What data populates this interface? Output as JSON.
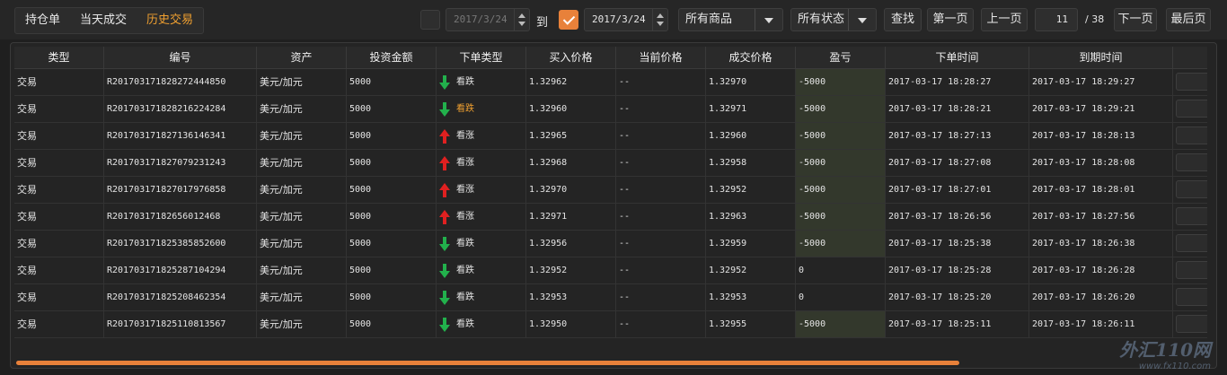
{
  "tabs": [
    {
      "label": "持仓单",
      "active": false
    },
    {
      "label": "当天成交",
      "active": false
    },
    {
      "label": "历史交易",
      "active": true
    }
  ],
  "filters": {
    "start_date": "2017/3/24",
    "to_label": "到",
    "end_date": "2017/3/24",
    "product_select": "所有商品",
    "status_select": "所有状态",
    "search_label": "查找"
  },
  "pagination": {
    "first_label": "第一页",
    "prev_label": "上一页",
    "current_page": "11",
    "total_pages": "/ 38",
    "next_label": "下一页",
    "last_label": "最后页"
  },
  "columns": [
    "类型",
    "编号",
    "资产",
    "投资金额",
    "下单类型",
    "买入价格",
    "当前价格",
    "成交价格",
    "盈亏",
    "下单时间",
    "到期时间"
  ],
  "rows": [
    {
      "type": "交易",
      "id": "R201703171828272444850",
      "asset": "美元/加元",
      "amount": "5000",
      "dir": "down",
      "dir_label": "看跌",
      "dir_highlight": false,
      "buy": "1.32962",
      "current": "--",
      "deal": "1.32970",
      "pl": "-5000",
      "pl_neg": true,
      "order_time": "2017-03-17 18:28:27",
      "expire_time": "2017-03-17 18:29:27"
    },
    {
      "type": "交易",
      "id": "R201703171828216224284",
      "asset": "美元/加元",
      "amount": "5000",
      "dir": "down",
      "dir_label": "看跌",
      "dir_highlight": true,
      "buy": "1.32960",
      "current": "--",
      "deal": "1.32971",
      "pl": "-5000",
      "pl_neg": true,
      "order_time": "2017-03-17 18:28:21",
      "expire_time": "2017-03-17 18:29:21"
    },
    {
      "type": "交易",
      "id": "R201703171827136146341",
      "asset": "美元/加元",
      "amount": "5000",
      "dir": "up",
      "dir_label": "看涨",
      "dir_highlight": false,
      "buy": "1.32965",
      "current": "--",
      "deal": "1.32960",
      "pl": "-5000",
      "pl_neg": true,
      "order_time": "2017-03-17 18:27:13",
      "expire_time": "2017-03-17 18:28:13"
    },
    {
      "type": "交易",
      "id": "R201703171827079231243",
      "asset": "美元/加元",
      "amount": "5000",
      "dir": "up",
      "dir_label": "看涨",
      "dir_highlight": false,
      "buy": "1.32968",
      "current": "--",
      "deal": "1.32958",
      "pl": "-5000",
      "pl_neg": true,
      "order_time": "2017-03-17 18:27:08",
      "expire_time": "2017-03-17 18:28:08"
    },
    {
      "type": "交易",
      "id": "R201703171827017976858",
      "asset": "美元/加元",
      "amount": "5000",
      "dir": "up",
      "dir_label": "看涨",
      "dir_highlight": false,
      "buy": "1.32970",
      "current": "--",
      "deal": "1.32952",
      "pl": "-5000",
      "pl_neg": true,
      "order_time": "2017-03-17 18:27:01",
      "expire_time": "2017-03-17 18:28:01"
    },
    {
      "type": "交易",
      "id": "R20170317182656012468",
      "asset": "美元/加元",
      "amount": "5000",
      "dir": "up",
      "dir_label": "看涨",
      "dir_highlight": false,
      "buy": "1.32971",
      "current": "--",
      "deal": "1.32963",
      "pl": "-5000",
      "pl_neg": true,
      "order_time": "2017-03-17 18:26:56",
      "expire_time": "2017-03-17 18:27:56"
    },
    {
      "type": "交易",
      "id": "R201703171825385852600",
      "asset": "美元/加元",
      "amount": "5000",
      "dir": "down",
      "dir_label": "看跌",
      "dir_highlight": false,
      "buy": "1.32956",
      "current": "--",
      "deal": "1.32959",
      "pl": "-5000",
      "pl_neg": true,
      "order_time": "2017-03-17 18:25:38",
      "expire_time": "2017-03-17 18:26:38"
    },
    {
      "type": "交易",
      "id": "R201703171825287104294",
      "asset": "美元/加元",
      "amount": "5000",
      "dir": "down",
      "dir_label": "看跌",
      "dir_highlight": false,
      "buy": "1.32952",
      "current": "--",
      "deal": "1.32952",
      "pl": "0",
      "pl_neg": false,
      "order_time": "2017-03-17 18:25:28",
      "expire_time": "2017-03-17 18:26:28"
    },
    {
      "type": "交易",
      "id": "R201703171825208462354",
      "asset": "美元/加元",
      "amount": "5000",
      "dir": "down",
      "dir_label": "看跌",
      "dir_highlight": false,
      "buy": "1.32953",
      "current": "--",
      "deal": "1.32953",
      "pl": "0",
      "pl_neg": false,
      "order_time": "2017-03-17 18:25:20",
      "expire_time": "2017-03-17 18:26:20"
    },
    {
      "type": "交易",
      "id": "R201703171825110813567",
      "asset": "美元/加元",
      "amount": "5000",
      "dir": "down",
      "dir_label": "看跌",
      "dir_highlight": false,
      "buy": "1.32950",
      "current": "--",
      "deal": "1.32955",
      "pl": "-5000",
      "pl_neg": true,
      "order_time": "2017-03-17 18:25:11",
      "expire_time": "2017-03-17 18:26:11"
    }
  ],
  "watermark": {
    "logo": "外汇110网",
    "url": "www.fx110.com"
  },
  "colors": {
    "accent": "#e8813a",
    "tab_active": "#f0a030",
    "up_arrow": "#e02020",
    "down_arrow": "#22b14c",
    "loss_cell": "#33382c"
  }
}
